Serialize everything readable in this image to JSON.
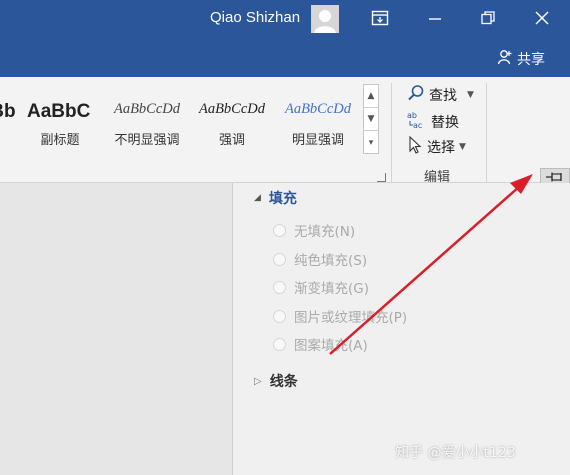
{
  "titlebar": {
    "user_name": "Qiao Shizhan",
    "bg_color": "#2b579a"
  },
  "header": {
    "share_label": "共享"
  },
  "styles_gallery": {
    "items": [
      {
        "sample": "AaBbC(",
        "label": ""
      },
      {
        "sample": "AaBbC",
        "label": "副标题"
      },
      {
        "sample": "AaBbCcDd",
        "label": "不明显强调"
      },
      {
        "sample": "AaBbCcDd",
        "label": "强调"
      },
      {
        "sample": "AaBbCcDd",
        "label": "明显强调"
      }
    ]
  },
  "editing": {
    "find_label": "查找",
    "replace_label": "替换",
    "select_label": "选择",
    "group_label": "编辑"
  },
  "format_pane": {
    "fill_section": {
      "title": "填充",
      "options": [
        {
          "label": "无填充(N)"
        },
        {
          "label": "纯色填充(S)"
        },
        {
          "label": "渐变填充(G)"
        },
        {
          "label": "图片或纹理填充(P)"
        },
        {
          "label": "图案填充(A)"
        }
      ]
    },
    "line_section": {
      "title": "线条"
    }
  },
  "watermark": "知乎 @爱小小t123"
}
